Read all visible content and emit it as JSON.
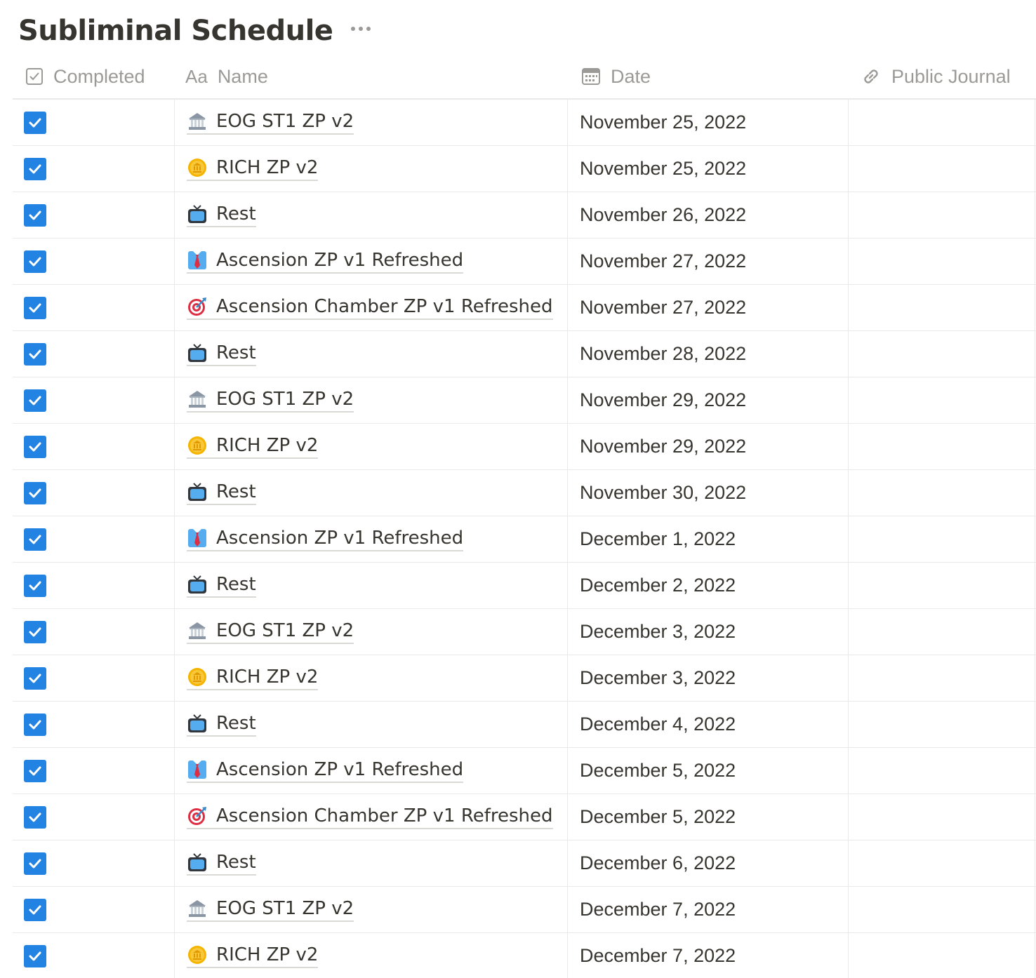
{
  "page": {
    "title": "Subliminal Schedule",
    "more_icon": "ellipsis-icon"
  },
  "columns": {
    "completed": {
      "label": "Completed",
      "icon": "checkbox-property-icon"
    },
    "name": {
      "label": "Name",
      "icon": "text-property-icon",
      "icon_text": "Aa"
    },
    "date": {
      "label": "Date",
      "icon": "calendar-icon"
    },
    "journal": {
      "label": "Public Journal",
      "icon": "link-icon"
    }
  },
  "colors": {
    "checkbox": "#2383e2",
    "text": "#37352f",
    "muted": "#9b9a97"
  },
  "rows": [
    {
      "completed": true,
      "icon": "bank",
      "name": "EOG ST1 ZP v2",
      "date": "November 25, 2022",
      "journal": ""
    },
    {
      "completed": true,
      "icon": "coin",
      "name": "RICH ZP v2",
      "date": "November 25, 2022",
      "journal": ""
    },
    {
      "completed": true,
      "icon": "tv",
      "name": "Rest",
      "date": "November 26, 2022",
      "journal": ""
    },
    {
      "completed": true,
      "icon": "tie",
      "name": "Ascension ZP v1 Refreshed",
      "date": "November 27, 2022",
      "journal": ""
    },
    {
      "completed": true,
      "icon": "target",
      "name": "Ascension Chamber ZP v1 Refreshed",
      "date": "November 27, 2022",
      "journal": ""
    },
    {
      "completed": true,
      "icon": "tv",
      "name": "Rest",
      "date": "November 28, 2022",
      "journal": ""
    },
    {
      "completed": true,
      "icon": "bank",
      "name": "EOG ST1 ZP v2",
      "date": "November 29, 2022",
      "journal": ""
    },
    {
      "completed": true,
      "icon": "coin",
      "name": "RICH ZP v2",
      "date": "November 29, 2022",
      "journal": ""
    },
    {
      "completed": true,
      "icon": "tv",
      "name": "Rest",
      "date": "November 30, 2022",
      "journal": ""
    },
    {
      "completed": true,
      "icon": "tie",
      "name": "Ascension ZP v1 Refreshed",
      "date": "December 1, 2022",
      "journal": ""
    },
    {
      "completed": true,
      "icon": "tv",
      "name": "Rest",
      "date": "December 2, 2022",
      "journal": ""
    },
    {
      "completed": true,
      "icon": "bank",
      "name": "EOG ST1 ZP v2",
      "date": "December 3, 2022",
      "journal": ""
    },
    {
      "completed": true,
      "icon": "coin",
      "name": "RICH ZP v2",
      "date": "December 3, 2022",
      "journal": ""
    },
    {
      "completed": true,
      "icon": "tv",
      "name": "Rest",
      "date": "December 4, 2022",
      "journal": ""
    },
    {
      "completed": true,
      "icon": "tie",
      "name": "Ascension ZP v1 Refreshed",
      "date": "December 5, 2022",
      "journal": ""
    },
    {
      "completed": true,
      "icon": "target",
      "name": "Ascension Chamber ZP v1 Refreshed",
      "date": "December 5, 2022",
      "journal": ""
    },
    {
      "completed": true,
      "icon": "tv",
      "name": "Rest",
      "date": "December 6, 2022",
      "journal": ""
    },
    {
      "completed": true,
      "icon": "bank",
      "name": "EOG ST1 ZP v2",
      "date": "December 7, 2022",
      "journal": ""
    },
    {
      "completed": true,
      "icon": "coin",
      "name": "RICH ZP v2",
      "date": "December 7, 2022",
      "journal": ""
    }
  ]
}
